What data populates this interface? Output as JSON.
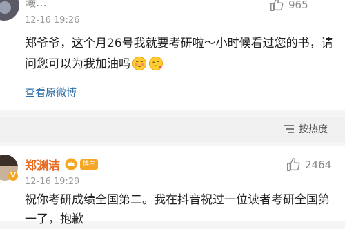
{
  "top_comment": {
    "username": "曦…",
    "time": "12-16 19:26",
    "likes": "965",
    "text": "郑爷爷，这个月26号我就要考研啦～小时候看过您的书，请问您可以为我加油吗",
    "emojis": [
      "shy-face-emoji",
      "kiss-heart-emoji"
    ],
    "view_original": "查看原微博"
  },
  "sort_bar": {
    "label": "按热度"
  },
  "bottom_comment": {
    "username": "郑渊洁",
    "badge": "博主",
    "time": "12-16 19:29",
    "likes": "2464",
    "text": "祝你考研成绩全国第二。我在抖音祝过一位读者考研全国第一了，抱歉"
  },
  "colors": {
    "link": "#2f6fa8",
    "author_name": "#e86a20",
    "badge": "#f5a623"
  }
}
